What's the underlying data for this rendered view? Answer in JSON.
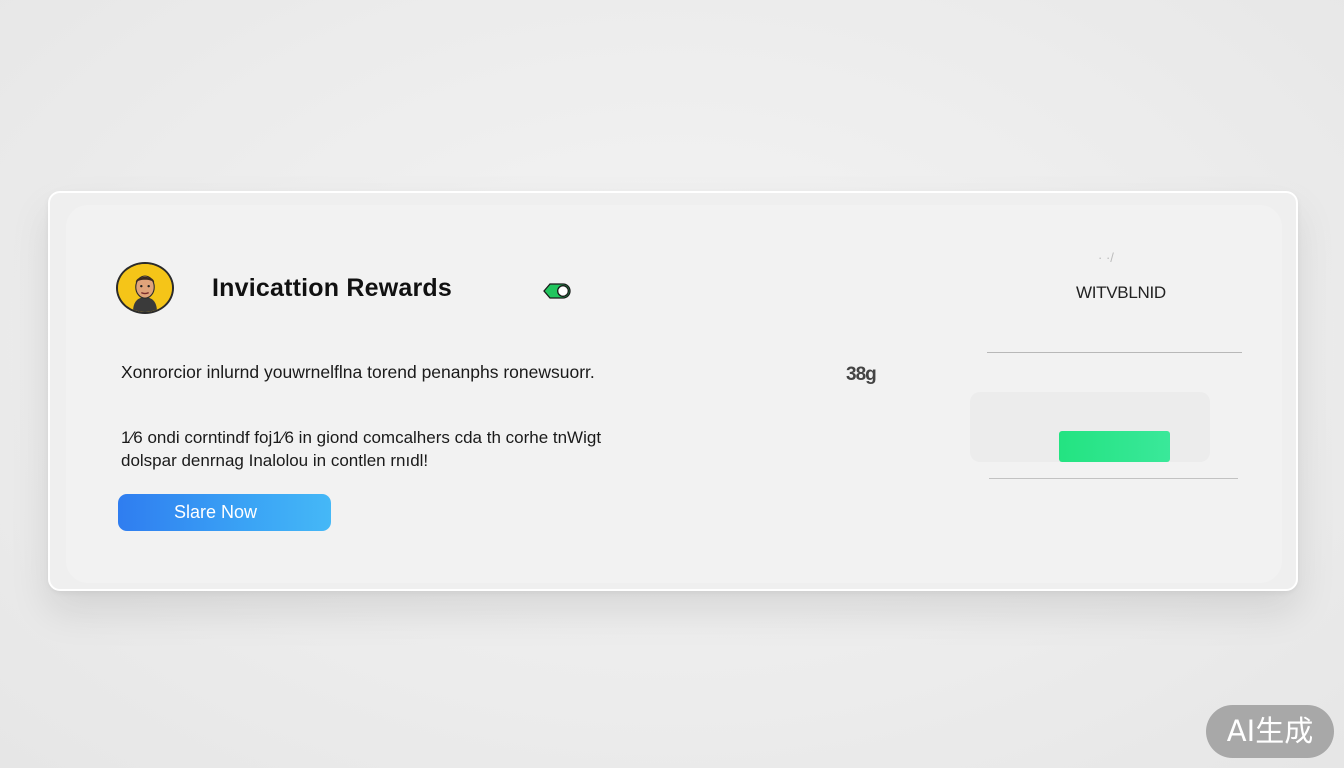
{
  "reward_card": {
    "title": "Invicattion Rewards",
    "avatar_icon": "user-avatar-icon",
    "toggle_state": "on",
    "toggle_color": "#22c55e",
    "right_header": "WITVBLNID",
    "faint_mark": "· ·/",
    "description": "Xonrorcior inlurnd youwrnelflna torend penanphs ronewsuorr.",
    "count": "38g",
    "details": [
      "1⁄6 ondi corntindf foj1⁄6  in giond comcalhers cda th corhe tnWigt",
      "dolspar denrnag Inalolou in contlen rnıdl!"
    ],
    "share_button_label": "Slare Now",
    "accent_green": "#23e381",
    "accent_blue": "#2f7df0"
  },
  "watermark": "AI生成"
}
